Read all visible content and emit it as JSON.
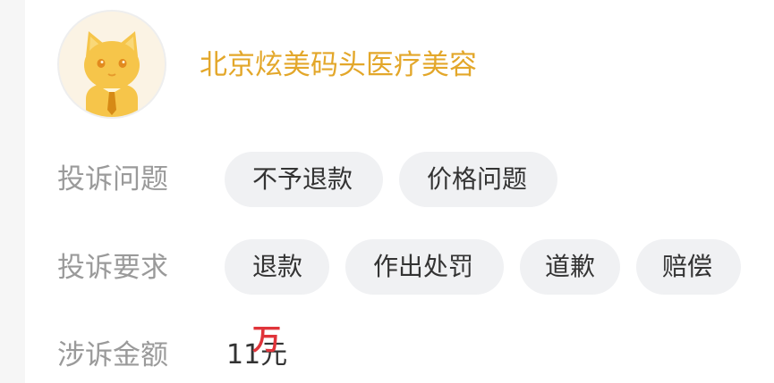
{
  "company": {
    "name": "北京炫美码头医疗美容"
  },
  "complaint_issue": {
    "label": "投诉问题",
    "tags": [
      "不予退款",
      "价格问题"
    ]
  },
  "complaint_request": {
    "label": "投诉要求",
    "tags": [
      "退款",
      "作出处罚",
      "道歉",
      "赔偿"
    ]
  },
  "complaint_amount": {
    "label": "涉诉金额",
    "value": "11元",
    "overlay_text": "万"
  },
  "colors": {
    "brand": "#e3a72a",
    "label": "#9a9a9a",
    "chip_bg": "#f0f1f3",
    "overlay": "#e0343a"
  }
}
